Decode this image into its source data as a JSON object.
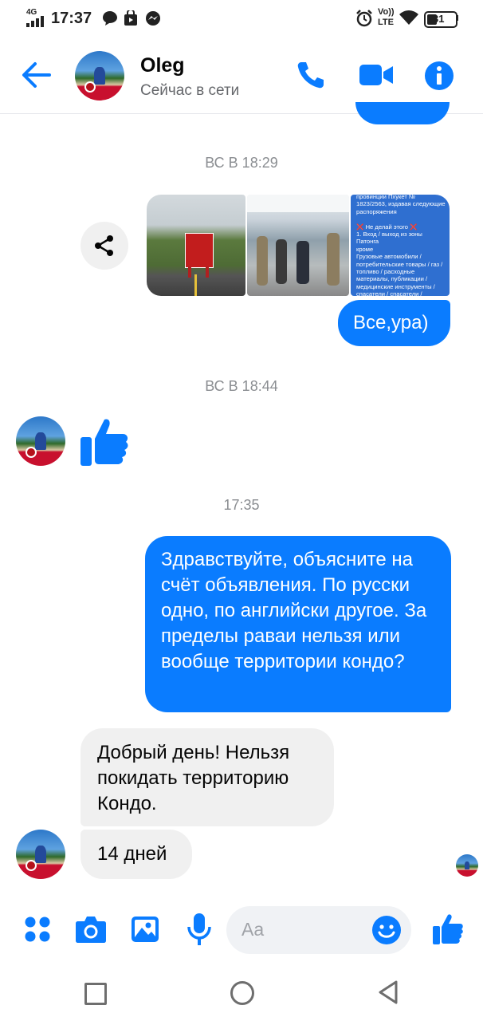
{
  "status_bar": {
    "network": "4G",
    "time": "17:37",
    "volte": "Vo))",
    "lte": "LTE",
    "battery": "31"
  },
  "header": {
    "contact_name": "Oleg",
    "presence": "Сейчас в сети"
  },
  "messages": {
    "ts1": "ВС В 18:29",
    "photo_text": "провинции Пхукет № 1823/2563, издавая следующие распоряжения\n\n❌ Не делай этого ❌\n1. Вход / выход из зоны Патонга\nкроме\nГрузовые автомобили / потребительские товары / газ / топливо / расходные материалы, публикации / медицинские инструменты / спасатели / спасатели /",
    "msg1": "Все,ура)",
    "ts2": "ВС В 18:44",
    "ts3": "17:35",
    "msg2": "Здравствуйте, объясните на счёт объявления. По русски одно, по английски другое. За пределы раваи нельзя или вообще территории кондо?",
    "msg3": "Добрый день! Нельзя покидать территорию Кондо.",
    "msg4": "14 дней"
  },
  "composer": {
    "placeholder": "Aa"
  },
  "colors": {
    "accent": "#0a7cff",
    "outgoing_bubble": "#0a7cff",
    "incoming_bubble": "#f0f0f0"
  }
}
